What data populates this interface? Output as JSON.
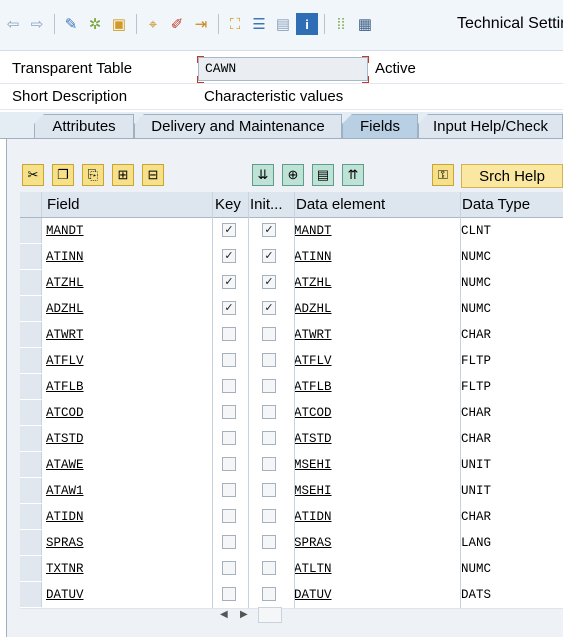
{
  "toolbar": {
    "title": "Technical Settin",
    "icons": [
      "back-icon",
      "forward-icon",
      "display-change-icon",
      "other-object-icon",
      "activate-icon",
      "where-used-icon",
      "edit-icon",
      "technical-settings-icon",
      "hierarchy-icon",
      "indexes-icon",
      "append-structure-icon",
      "info-icon",
      "field-list-icon",
      "table-icon"
    ]
  },
  "header": {
    "table_type_label": "Transparent Table",
    "table_name": "CAWN",
    "status": "Active",
    "short_desc_label": "Short Description",
    "short_desc_value": "Characteristic values"
  },
  "tabs": [
    {
      "label": "Attributes",
      "active": false
    },
    {
      "label": "Delivery and Maintenance",
      "active": false
    },
    {
      "label": "Fields",
      "active": true
    },
    {
      "label": "Input Help/Check",
      "active": false
    }
  ],
  "fields_toolbar": {
    "search_help_label": "Srch Help",
    "icons": [
      "cut-icon",
      "copy-icon",
      "paste-icon",
      "insert-row-icon",
      "delete-row-icon",
      "move-down-icon",
      "insert-field-icon",
      "details-icon",
      "move-up-icon",
      "new-entry-icon"
    ]
  },
  "table": {
    "columns": [
      "Field",
      "Key",
      "Init...",
      "Data element",
      "Data Type"
    ],
    "rows": [
      {
        "field": "MANDT",
        "key": true,
        "init": true,
        "data_element": "MANDT",
        "data_type": "CLNT"
      },
      {
        "field": "ATINN",
        "key": true,
        "init": true,
        "data_element": "ATINN",
        "data_type": "NUMC"
      },
      {
        "field": "ATZHL",
        "key": true,
        "init": true,
        "data_element": "ATZHL",
        "data_type": "NUMC"
      },
      {
        "field": "ADZHL",
        "key": true,
        "init": true,
        "data_element": "ADZHL",
        "data_type": "NUMC"
      },
      {
        "field": "ATWRT",
        "key": false,
        "init": false,
        "data_element": "ATWRT",
        "data_type": "CHAR"
      },
      {
        "field": "ATFLV",
        "key": false,
        "init": false,
        "data_element": "ATFLV",
        "data_type": "FLTP"
      },
      {
        "field": "ATFLB",
        "key": false,
        "init": false,
        "data_element": "ATFLB",
        "data_type": "FLTP"
      },
      {
        "field": "ATCOD",
        "key": false,
        "init": false,
        "data_element": "ATCOD",
        "data_type": "CHAR"
      },
      {
        "field": "ATSTD",
        "key": false,
        "init": false,
        "data_element": "ATSTD",
        "data_type": "CHAR"
      },
      {
        "field": "ATAWE",
        "key": false,
        "init": false,
        "data_element": "MSEHI",
        "data_type": "UNIT"
      },
      {
        "field": "ATAW1",
        "key": false,
        "init": false,
        "data_element": "MSEHI",
        "data_type": "UNIT"
      },
      {
        "field": "ATIDN",
        "key": false,
        "init": false,
        "data_element": "ATIDN",
        "data_type": "CHAR"
      },
      {
        "field": "SPRAS",
        "key": false,
        "init": false,
        "data_element": "SPRAS",
        "data_type": "LANG"
      },
      {
        "field": "TXTNR",
        "key": false,
        "init": false,
        "data_element": "ATLTN",
        "data_type": "NUMC"
      },
      {
        "field": "DATUV",
        "key": false,
        "init": false,
        "data_element": "DATUV",
        "data_type": "DATS"
      }
    ]
  },
  "colors": {
    "panel": "#eef2f6",
    "tab_active": "#b9cfe4",
    "button_yellow": "#f7e08a",
    "required_marker": "#c0392b"
  }
}
